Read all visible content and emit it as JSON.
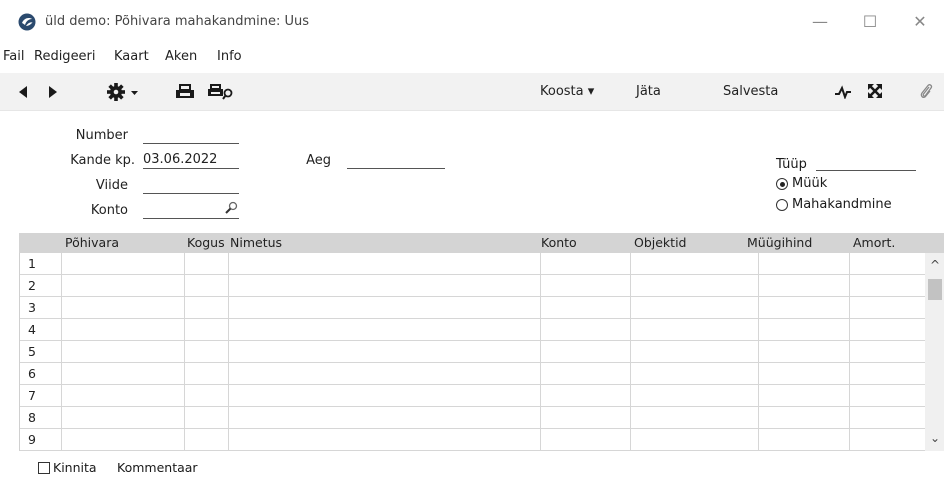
{
  "window": {
    "title": "üld demo: Põhivara mahakandmine: Uus",
    "minimize_glyph": "—",
    "maximize_glyph": "☐",
    "close_glyph": "✕"
  },
  "menu": {
    "items": [
      "Fail",
      "Redigeeri",
      "Kaart",
      "Aken",
      "Info"
    ]
  },
  "toolbar": {
    "koosta_label": "Koosta ▾",
    "jata_label": "Jäta",
    "salvesta_label": "Salvesta"
  },
  "form": {
    "number_label": "Number",
    "number_value": "",
    "kande_kp_label": "Kande kp.",
    "kande_kp_value": "03.06.2022",
    "aeg_label": "Aeg",
    "aeg_value": "",
    "viide_label": "Viide",
    "viide_value": "",
    "konto_label": "Konto",
    "konto_value": "",
    "tyyp_label": "Tüüp",
    "tyyp_options": [
      "Müük",
      "Mahakandmine"
    ],
    "tyyp_selected": "Müük"
  },
  "grid": {
    "columns": [
      "Põhivara",
      "Kogus",
      "Nimetus",
      "Konto",
      "Objektid",
      "Müügihind",
      "Amort."
    ],
    "row_numbers": [
      "1",
      "2",
      "3",
      "4",
      "5",
      "6",
      "7",
      "8",
      "9"
    ],
    "scroll_up": "^",
    "scroll_down": "⌄"
  },
  "footer": {
    "kinnita_label": "Kinnita",
    "kinnita_checked": false,
    "kommentaar_label": "Kommentaar"
  },
  "colors": {
    "toolbar_bg": "#f2f2f2",
    "grid_header_bg": "#d4d4d4",
    "logo": "#2b4a6e"
  }
}
